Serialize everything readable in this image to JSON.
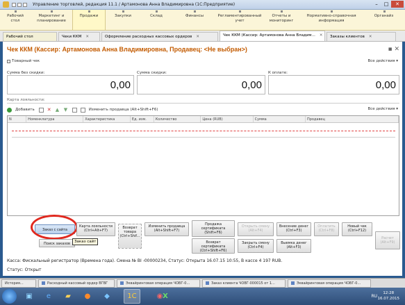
{
  "window": {
    "title": "Управление торговлей, редакция 11.1 / Артамонова Анна Владимировна (1С:Предприятие)"
  },
  "sections": [
    {
      "label": "Рабочий\nстол"
    },
    {
      "label": "Маркетинг и\nпланирование"
    },
    {
      "label": "Продажи"
    },
    {
      "label": "Закупки"
    },
    {
      "label": "Склад"
    },
    {
      "label": "Финансы"
    },
    {
      "label": "Регламентированный\nучет"
    },
    {
      "label": "Отчеты и\nмониторинг"
    },
    {
      "label": "Нормативно-справочная\nинформация"
    },
    {
      "label": "Органайз"
    }
  ],
  "tabs": [
    {
      "label": "Рабочий стол"
    },
    {
      "label": "Чеки ККМ"
    },
    {
      "label": "Оформление расходных кассовых ордеров"
    },
    {
      "label": "Чек ККМ (Кассир: Артамонова Анна Владим..."
    },
    {
      "label": "Заказы клиентов"
    }
  ],
  "document": {
    "title": "Чек ККМ (Кассир: Артамонова Анна Владимировна, Продавец: <Не выбран>)",
    "product_check_label": "Товарный чек",
    "all_actions": "Все действия",
    "sum_without_discount_label": "Сумма без скидки:",
    "sum_discount_label": "Сумма скидки:",
    "to_pay_label": "К оплате:",
    "sum_without_discount": "0,00",
    "sum_discount": "0,00",
    "to_pay": "0,00",
    "loyalty_label": "Карта лояльности:"
  },
  "grid_toolbar": {
    "add_label": "Добавить",
    "change_seller_label": "Изменить продавца (Alt+Shift+F6)",
    "all_actions": "Все действия"
  },
  "grid": {
    "columns": [
      "N",
      "Номенклатура",
      "Характеристика",
      "Ед. изм.",
      "Количество",
      "Цена (RUB)",
      "Сумма",
      "Продавец"
    ]
  },
  "buttons": {
    "order_from_site": "Заказ с сайта",
    "loyalty_card": "Карта лояльности\n(Ctrl+Alt+F7)",
    "return_goods": "Возврат\nтовара\n(Ctrl+Shif...",
    "change_seller": "Изменить продавца\n(Alt+Shift+F7)",
    "sell_certificate": "Продажа\nсертификата\n(Shift+F6)",
    "return_certificate": "Возврат\nсертификата\n(Ctrl+Shift+F6)",
    "open_shift": "Открыть смену\n(Alt+F4)",
    "close_shift": "Закрыть смену\n(Ctrl+F4)",
    "cash_in": "Внесение денег\n(Ctrl+F3)",
    "cash_out": "Выемка денег\n(Alt+F3)",
    "pay": "Оплатить\n(Ctrl+F8)",
    "new_check": "Новый чек\n(Ctrl+F12)",
    "calc": "Расчет\n(Alt+F9)",
    "search_orders": "Поиск заказов",
    "tooltip": "Заказ сайт"
  },
  "status": {
    "kassa_line": "Касса: Фискальный регистратор (Времена года). Смена № ВI -00000234, Статус: Открыта 16.07.15 10:55, В кассе 4 197 RUB.",
    "status_line": "Статус:  Открыт"
  },
  "taskbar_tabs": [
    {
      "label": "История..."
    },
    {
      "label": "Расходный кассовый ордер ВГВГ"
    },
    {
      "label": "Эквайринговая операция ЧОВГ-0..."
    },
    {
      "label": "Заказ клиента ЧОВГ-000015 от 1..."
    },
    {
      "label": "Эквайринговая операция ЧОВГ-0..."
    }
  ],
  "clock": {
    "time": "12:28",
    "date": "16.07.2015"
  },
  "tray": {
    "lang": "RU"
  }
}
